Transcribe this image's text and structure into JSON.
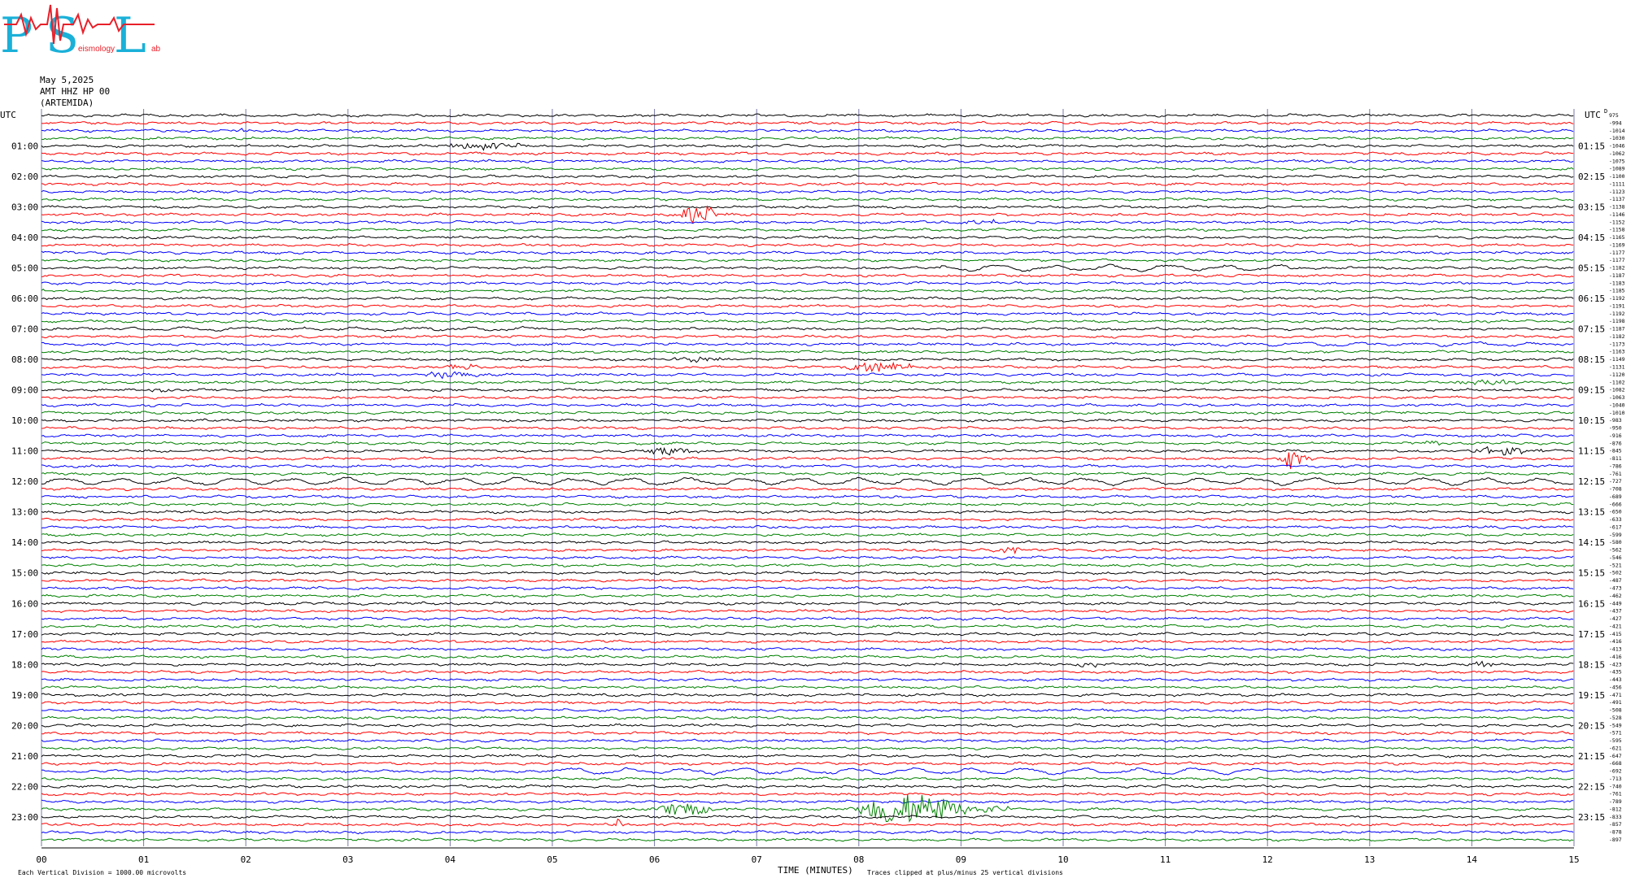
{
  "logo": {
    "letters": [
      "P",
      "S",
      "L"
    ],
    "small_words": [
      "eismology",
      "ab"
    ],
    "colors": {
      "cyan": "#1ab0d8",
      "red": "#e8202a"
    }
  },
  "header": {
    "date": "May 5,2025",
    "station": "AMT HHZ HP 00",
    "name": "(ARTEMIDA)"
  },
  "chart_data": {
    "type": "line",
    "title": "",
    "left_axis_label": "UTC",
    "right_axis_label": "UTC",
    "xlabel": "TIME (MINUTES)",
    "x_ticks": [
      "00",
      "01",
      "02",
      "03",
      "04",
      "05",
      "06",
      "07",
      "08",
      "09",
      "10",
      "11",
      "12",
      "13",
      "14",
      "15"
    ],
    "xlim": [
      0,
      15
    ],
    "row_count": 96,
    "row_color_cycle": [
      "#000000",
      "#ff0000",
      "#0000ff",
      "#008000"
    ],
    "grid_color": "#7a7aa8",
    "left_hour_labels": [
      "01:00",
      "02:00",
      "03:00",
      "04:00",
      "05:00",
      "06:00",
      "07:00",
      "08:00",
      "09:00",
      "10:00",
      "11:00",
      "12:00",
      "13:00",
      "14:00",
      "15:00",
      "16:00",
      "17:00",
      "18:00",
      "19:00",
      "20:00",
      "21:00",
      "22:00",
      "23:00"
    ],
    "right_hour_labels": [
      "01:15",
      "02:15",
      "03:15",
      "04:15",
      "05:15",
      "06:15",
      "07:15",
      "08:15",
      "09:15",
      "10:15",
      "11:15",
      "12:15",
      "13:15",
      "14:15",
      "15:15",
      "16:15",
      "17:15",
      "18:15",
      "19:15",
      "20:15",
      "21:15",
      "22:15",
      "23:15"
    ],
    "row_offsets_label": "D",
    "row_offsets": [
      "975",
      "-994",
      "-1014",
      "-1030",
      "-1046",
      "-1062",
      "-1075",
      "-1089",
      "-1100",
      "-1111",
      "-1123",
      "-1137",
      "-1138",
      "-1146",
      "-1152",
      "-1158",
      "-1165",
      "-1169",
      "-1177",
      "-1177",
      "-1182",
      "-1187",
      "-1183",
      "-1185",
      "-1192",
      "-1191",
      "-1192",
      "-1198",
      "-1187",
      "-1182",
      "-1173",
      "-1163",
      "-1149",
      "-1131",
      "-1120",
      "-1102",
      "-1082",
      "-1063",
      "-1040",
      "-1010",
      "-983",
      "-950",
      "-916",
      "-876",
      "-845",
      "-811",
      "-786",
      "-761",
      "-727",
      "-708",
      "-689",
      "-666",
      "-650",
      "-633",
      "-617",
      "-599",
      "-580",
      "-562",
      "-546",
      "-521",
      "-502",
      "-487",
      "-473",
      "-462",
      "-449",
      "-437",
      "-427",
      "-421",
      "-415",
      "-416",
      "-413",
      "-416",
      "-423",
      "-435",
      "-443",
      "-456",
      "-471",
      "-491",
      "-508",
      "-528",
      "-549",
      "-571",
      "-595",
      "-621",
      "-647",
      "-668",
      "-692",
      "-713",
      "-740",
      "-761",
      "-789",
      "-812",
      "-833",
      "-857",
      "-878",
      "-897"
    ],
    "events": [
      {
        "row": 2,
        "start_min": 1.9,
        "end_min": 2.1,
        "amp": 0.35
      },
      {
        "row": 4,
        "start_min": 3.8,
        "end_min": 5.2,
        "amp": 0.5
      },
      {
        "row": 13,
        "start_min": 6.2,
        "end_min": 6.8,
        "amp": 1.6
      },
      {
        "row": 14,
        "start_min": 8.9,
        "end_min": 9.8,
        "amp": 0.35
      },
      {
        "row": 20,
        "start_min": 8.8,
        "end_min": 12.2,
        "amp": 0.7
      },
      {
        "row": 28,
        "start_min": 0.7,
        "end_min": 5.0,
        "amp": 0.35
      },
      {
        "row": 30,
        "start_min": 11.3,
        "end_min": 14.9,
        "amp": 0.35
      },
      {
        "row": 32,
        "start_min": 6.1,
        "end_min": 7.0,
        "amp": 0.45
      },
      {
        "row": 33,
        "start_min": 7.7,
        "end_min": 8.9,
        "amp": 0.7
      },
      {
        "row": 33,
        "start_min": 3.9,
        "end_min": 4.5,
        "amp": 0.35
      },
      {
        "row": 34,
        "start_min": 3.6,
        "end_min": 4.5,
        "amp": 0.6
      },
      {
        "row": 35,
        "start_min": 13.8,
        "end_min": 14.8,
        "amp": 0.45
      },
      {
        "row": 36,
        "start_min": 1.0,
        "end_min": 1.4,
        "amp": 0.35
      },
      {
        "row": 43,
        "start_min": 13.3,
        "end_min": 14.0,
        "amp": 0.35
      },
      {
        "row": 44,
        "start_min": 5.8,
        "end_min": 6.6,
        "amp": 0.6
      },
      {
        "row": 44,
        "start_min": 13.9,
        "end_min": 14.9,
        "amp": 0.6
      },
      {
        "row": 45,
        "start_min": 12.1,
        "end_min": 12.5,
        "amp": 1.6
      },
      {
        "row": 48,
        "start_min": 0.0,
        "end_min": 15.0,
        "amp": 0.8
      },
      {
        "row": 57,
        "start_min": 9.3,
        "end_min": 9.8,
        "amp": 0.5
      },
      {
        "row": 72,
        "start_min": 10.1,
        "end_min": 10.5,
        "amp": 0.35
      },
      {
        "row": 72,
        "start_min": 13.9,
        "end_min": 14.5,
        "amp": 0.35
      },
      {
        "row": 86,
        "start_min": 5.0,
        "end_min": 12.0,
        "amp": 0.7
      },
      {
        "row": 91,
        "start_min": 6.0,
        "end_min": 6.8,
        "amp": 1.1
      },
      {
        "row": 91,
        "start_min": 7.9,
        "end_min": 9.5,
        "amp": 2.6
      },
      {
        "row": 93,
        "start_min": 5.6,
        "end_min": 5.7,
        "amp": 1.2
      }
    ]
  },
  "footer": {
    "left_note": "Each Vertical Division = 1000.00 microvolts",
    "clip_note": "Traces clipped at plus/minus 25 vertical divisions"
  }
}
